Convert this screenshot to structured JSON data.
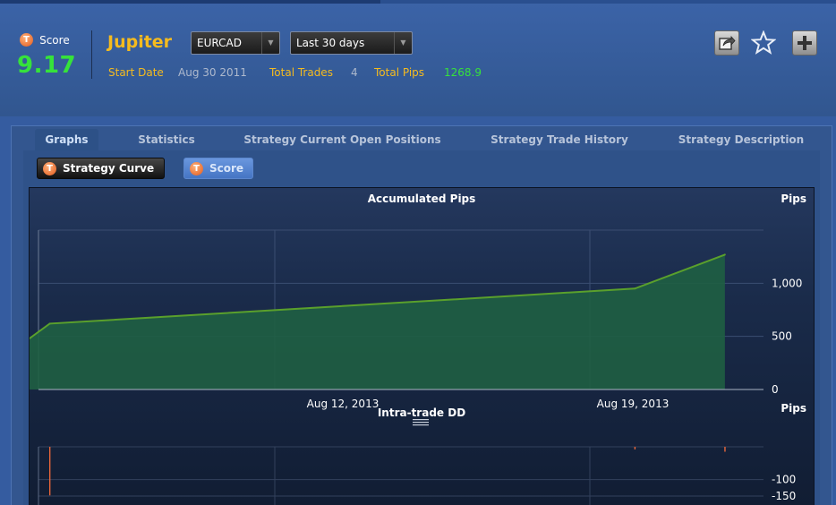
{
  "header": {
    "score_label": "Score",
    "score_value": "9.17",
    "score_badge": "T",
    "strategy_name": "Jupiter",
    "pair_select": "EURCAD",
    "period_select": "Last 30 days",
    "start_date_label": "Start Date",
    "start_date_value": "Aug 30 2011",
    "total_trades_label": "Total Trades",
    "total_trades_value": "4",
    "total_pips_label": "Total Pips",
    "total_pips_value": "1268.9",
    "icons": [
      "share-icon",
      "star-icon",
      "plus-icon"
    ]
  },
  "tabs": [
    {
      "label": "Graphs",
      "active": true
    },
    {
      "label": "Statistics",
      "active": false
    },
    {
      "label": "Strategy Current Open Positions",
      "active": false
    },
    {
      "label": "Strategy Trade History",
      "active": false
    },
    {
      "label": "Strategy Description",
      "active": false
    }
  ],
  "subtabs": [
    {
      "label": "Strategy Curve",
      "active": true
    },
    {
      "label": "Score",
      "active": false
    }
  ],
  "colors": {
    "accent_yellow": "#f5bb1f",
    "pips_green": "#36e23b",
    "curve_line": "#5aa02c",
    "curve_fill": "#1f5f43",
    "dd_bar": "#e8663a"
  },
  "chart_data": [
    {
      "type": "area",
      "title": "Accumulated Pips",
      "ylabel": "Pips",
      "ylim": [
        0,
        1500
      ],
      "yticks": [
        0,
        500,
        1000
      ],
      "ytick_labels": [
        "0",
        "500",
        "1,000"
      ],
      "xtick_labels": [
        "Aug 12, 2013",
        "Aug 19, 2013"
      ],
      "x": [
        "Aug 6, 2013",
        "Aug 7, 2013",
        "Aug 20, 2013",
        "Aug 22, 2013"
      ],
      "values": [
        310,
        620,
        950,
        1268.9
      ],
      "grid": true
    },
    {
      "type": "bar",
      "title": "Intra-trade DD",
      "ylabel": "Pips",
      "ylim": [
        -180,
        0
      ],
      "yticks": [
        -100,
        -150
      ],
      "ytick_labels": [
        "-100",
        "-150"
      ],
      "x": [
        "Aug 7, 2013",
        "Aug 20, 2013",
        "Aug 22, 2013"
      ],
      "values": [
        -148,
        -8,
        -15
      ],
      "grid": true
    }
  ]
}
